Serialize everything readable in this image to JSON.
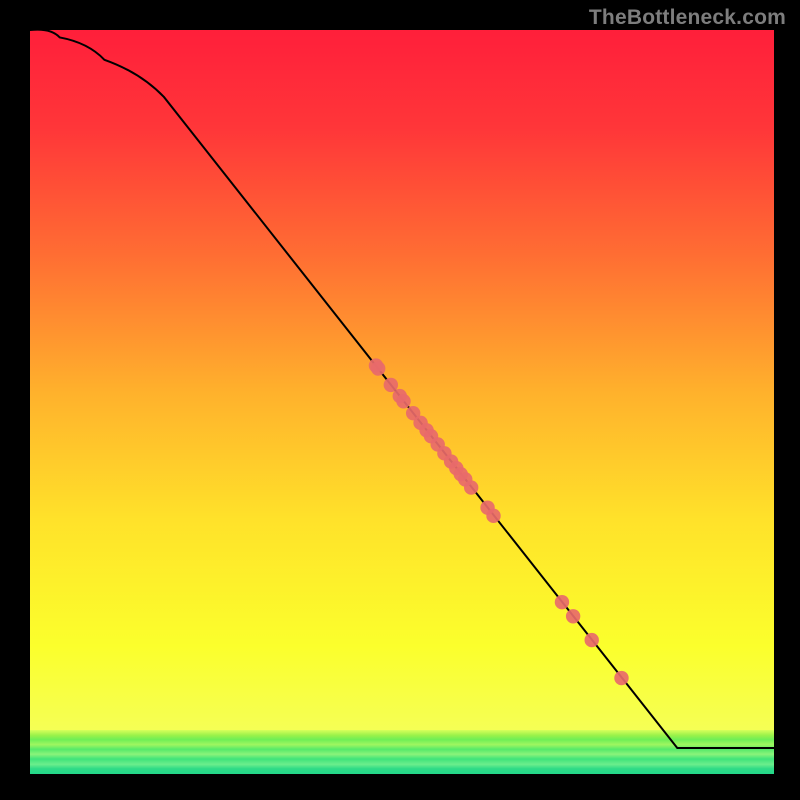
{
  "watermark": "TheBottleneck.com",
  "chart_data": {
    "type": "line",
    "title": "",
    "xlabel": "",
    "ylabel": "",
    "xlim": [
      0,
      100
    ],
    "ylim": [
      0,
      100
    ],
    "grid": false,
    "line": {
      "x": [
        0,
        4,
        10,
        18,
        87,
        100
      ],
      "y": [
        100,
        99,
        96,
        91,
        3.5,
        3.5
      ]
    },
    "markers": {
      "x": [
        46.5,
        46.8,
        48.5,
        49.7,
        50.2,
        51.5,
        52.5,
        53.3,
        53.9,
        54.8,
        55.7,
        56.6,
        57.3,
        57.9,
        58.5,
        59.3,
        61.5,
        62.3,
        71.5,
        73.0,
        75.5,
        79.5
      ],
      "y": [
        54.9,
        54.5,
        52.3,
        50.8,
        50.1,
        48.5,
        47.2,
        46.2,
        45.4,
        44.3,
        43.1,
        42.0,
        41.1,
        40.3,
        39.6,
        38.5,
        35.8,
        34.7,
        23.1,
        21.2,
        18.0,
        12.9
      ]
    },
    "colors": {
      "line": "#000000",
      "marker": "#e86a6a",
      "gradient_top": "#ff1f3a",
      "gradient_upper_mid": "#ff6a33",
      "gradient_mid": "#ffdc2d",
      "gradient_lower_mid": "#f7ff2b",
      "gradient_band_top": "#73f851",
      "gradient_band_bottom": "#26e07f"
    }
  }
}
